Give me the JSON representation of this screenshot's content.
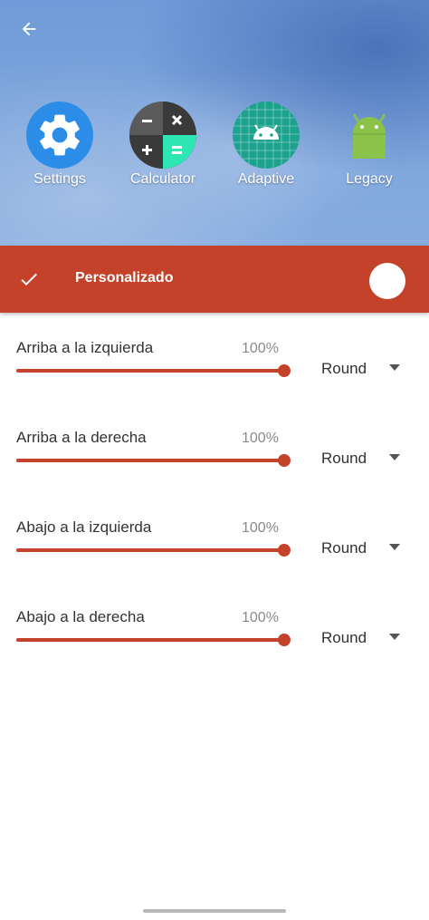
{
  "header": {
    "back_icon": "arrow-back-icon",
    "icon_previews": [
      {
        "label": "Settings",
        "icon": "gear-icon",
        "color": "#2b8de8"
      },
      {
        "label": "Calculator",
        "icon": "calculator-icon",
        "color": "#3d3d3d"
      },
      {
        "label": "Adaptive",
        "icon": "android-adaptive-icon",
        "color": "#1da28e"
      },
      {
        "label": "Legacy",
        "icon": "android-legacy-icon",
        "color": "#8bc34a"
      }
    ]
  },
  "toolbar": {
    "title": "Personalizado",
    "confirm_icon": "check-icon",
    "color_swatch": "#ffffff",
    "background_color": "#c4412a"
  },
  "corners": [
    {
      "label": "Arriba a la izquierda",
      "percent_text": "100%",
      "value": 1.0,
      "shape": "Round"
    },
    {
      "label": "Arriba a la derecha",
      "percent_text": "100%",
      "value": 1.0,
      "shape": "Round"
    },
    {
      "label": "Abajo a la izquierda",
      "percent_text": "100%",
      "value": 1.0,
      "shape": "Round"
    },
    {
      "label": "Abajo a la derecha",
      "percent_text": "100%",
      "value": 1.0,
      "shape": "Round"
    }
  ]
}
